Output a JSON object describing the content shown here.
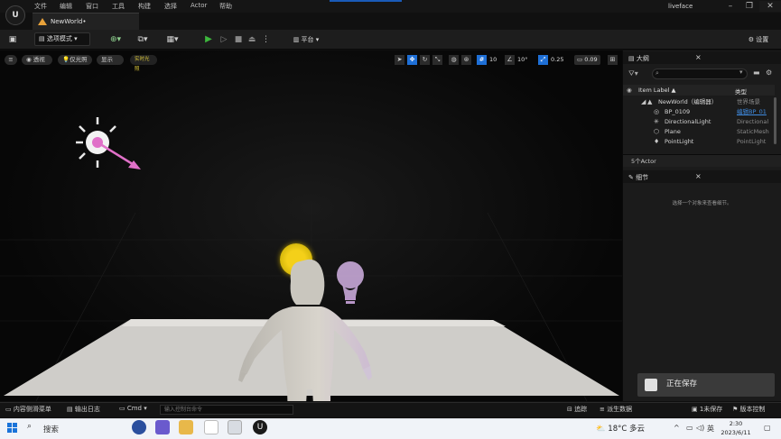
{
  "menu": {
    "items": [
      "文件",
      "编辑",
      "窗口",
      "工具",
      "构建",
      "选择",
      "Actor",
      "帮助"
    ],
    "window_title": "liveface"
  },
  "tabs": {
    "level_tab": "NewWorld•"
  },
  "toolbar": {
    "mode_label": "选项模式",
    "platform_label": "平台",
    "settings_label": "设置"
  },
  "viewport": {
    "perspective": "透视",
    "lit": "仅光照",
    "show": "显示",
    "realtime": "实时光照",
    "grid_snap": "10",
    "rotation_snap": "10°",
    "scale_snap": "0.25",
    "camera_speed": "0.09"
  },
  "outliner": {
    "tab_label": "大纲",
    "search_placeholder": "",
    "col_label": "Item Label ▲",
    "col_type": "类型",
    "rows": [
      {
        "name": "NewWorld（编辑器）",
        "type": "世界场景"
      },
      {
        "name": "BP_0109",
        "type": "编辑BP_01"
      },
      {
        "name": "DirectionalLight",
        "type": "Directional"
      },
      {
        "name": "Plane",
        "type": "StaticMesh"
      },
      {
        "name": "PointLight",
        "type": "PointLight"
      }
    ],
    "actor_count": "5个Actor"
  },
  "details": {
    "tab_label": "细节",
    "empty_text": "选择一个对象来查看细节。"
  },
  "toast": {
    "saving_text": "正在保存"
  },
  "statusbar": {
    "content_drawer": "内容侧滑菜单",
    "output_log": "输出日志",
    "cmd": "Cmd",
    "cmd_placeholder": "输入控制台命令",
    "trace": "追踪",
    "derived_data": "派生数据",
    "unsaved": "1未保存",
    "source_control": "版本控制"
  },
  "taskbar": {
    "search_label": "搜索",
    "weather": "18°C 多云",
    "ime": "英",
    "time": "2:30",
    "date": "2023/6/11"
  },
  "colors": {
    "accent_blue": "#1e6fd6",
    "play_green": "#3db83d",
    "bulb_yellow": "#f4d019",
    "bulb_purple": "#c8a8d8",
    "light_arrow": "#e070c8"
  }
}
